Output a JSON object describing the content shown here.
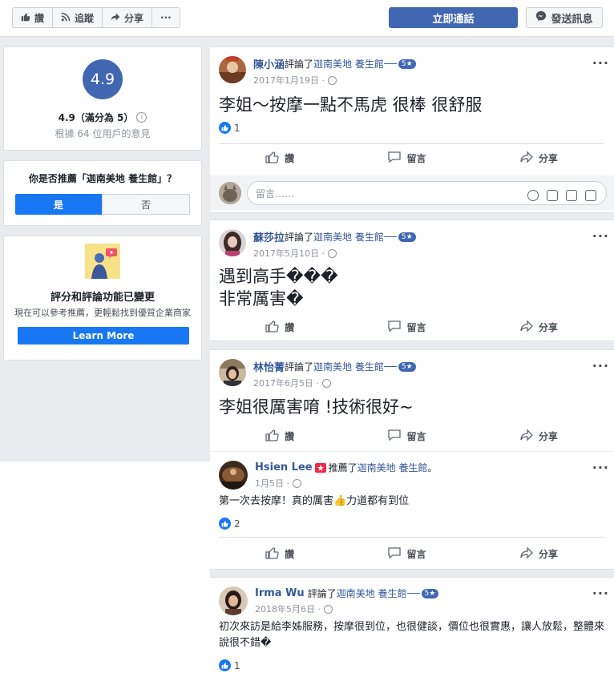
{
  "toolbar": {
    "like_label": "讚",
    "follow_label": "追蹤",
    "share_label": "分享",
    "more_label": "···",
    "call_label": "立即通話",
    "message_label": "發送訊息"
  },
  "rating": {
    "score": "4.9",
    "score_text": "4.9（滿分為 5）",
    "info_glyph": "i",
    "based_on": "根據 64 位用戶的意見"
  },
  "recommend": {
    "question": "你是否推薦「迦南美地 養生館」？",
    "yes_label": "是",
    "no_label": "否"
  },
  "promo": {
    "title": "評分和評論功能已變更",
    "description": "現在可以參考推薦，更輕鬆找到優質企業商家",
    "button_label": "Learn More"
  },
  "common": {
    "like_action": "讚",
    "comment_action": "留言",
    "share_action": "分享",
    "comment_placeholder": "留言……",
    "reviewed_text": "評論了",
    "recommended_text": "推薦了",
    "page_name": "迦南美地 養生館",
    "star_badge": "5★",
    "more_glyph": "···"
  },
  "posts": [
    {
      "author": "陳小涵",
      "date": "2017年1月19日 · ",
      "body": "李姐～按摩一點不馬虎 很棒 很舒服",
      "likes": "1"
    },
    {
      "author": "蘇莎拉",
      "date": "2017年5月10日 · ",
      "body_line1": "遇到高手���",
      "body_line2": "非常厲害�"
    },
    {
      "author": "林怡菁",
      "date": "2017年6月5日 · ",
      "body": "李姐很厲害唷 !技術很好~"
    },
    {
      "author": "Hsien Lee",
      "date": "1月5日 · ",
      "suffix": "。",
      "body": "第一次去按摩！真的厲害👍力道都有到位",
      "likes": "2"
    },
    {
      "author": "Irma Wu",
      "date": "2018年5月6日 · ",
      "body": "初次來訪是給李姊服務，按摩很到位，也很健談，價位也很實惠，讓人放鬆，整體來說很不錯�",
      "likes": "1"
    }
  ]
}
